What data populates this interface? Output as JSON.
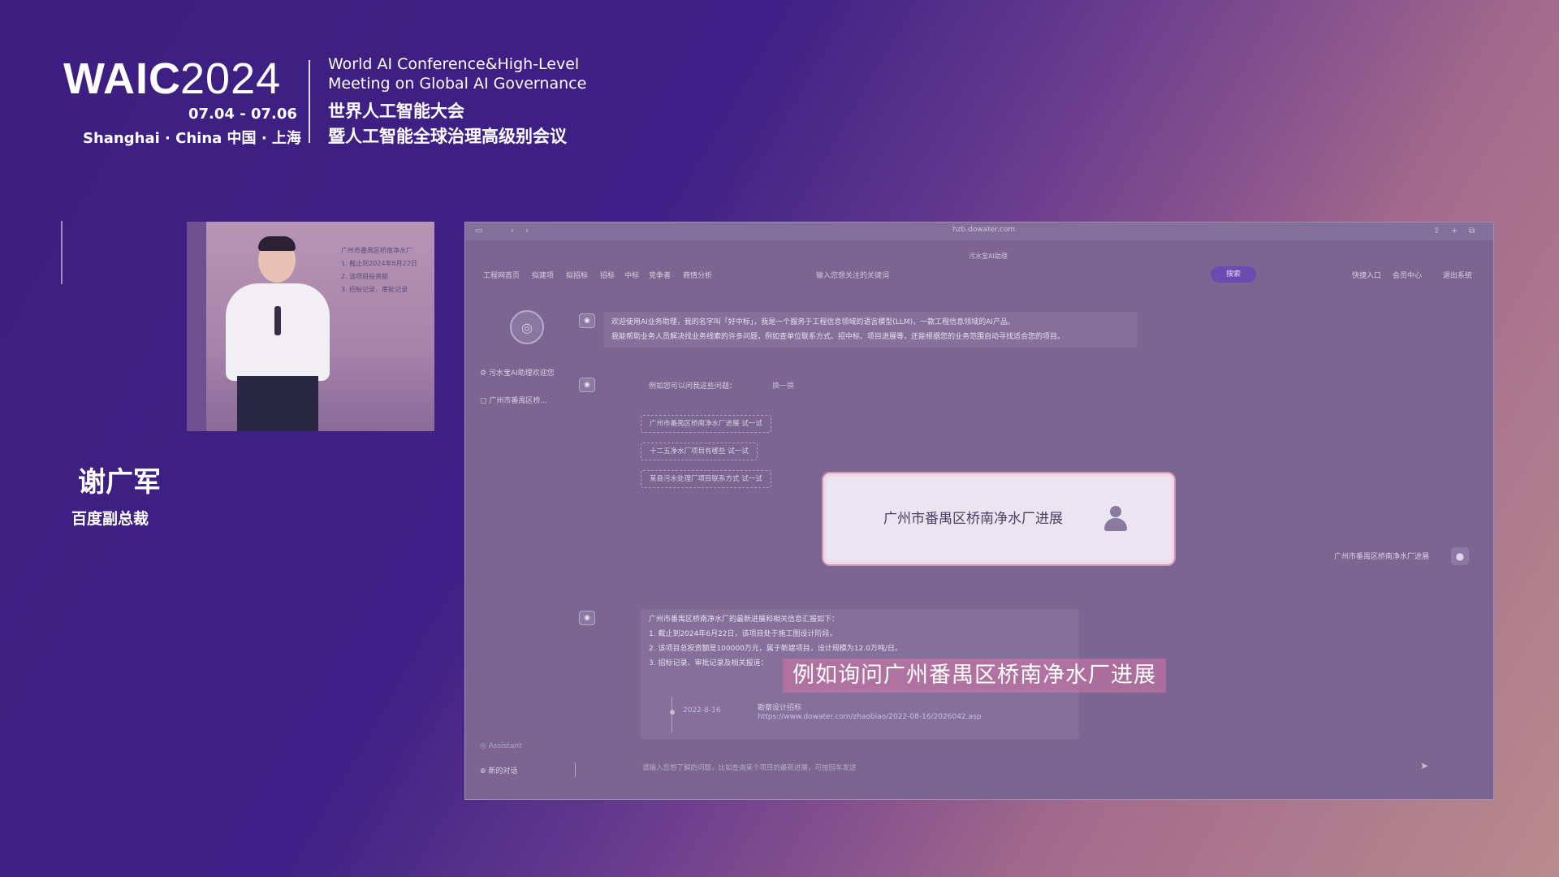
{
  "event": {
    "logo_word": "WAIC",
    "logo_year": "2024",
    "dates": "07.04 - 07.06",
    "location": "Shanghai · China  中国 · 上海",
    "name_en_line1": "World AI Conference&High-Level",
    "name_en_line2": "Meeting on Global AI Governance",
    "name_cn_line1": "世界人工智能大会",
    "name_cn_line2": "暨人工智能全球治理高级别会议"
  },
  "speaker": {
    "name": "谢广军",
    "title": "百度副总裁",
    "video_screen_text": [
      "广州市番禺区桥南净水厂",
      "1. 截止到2024年6月22日",
      "2. 该项目投资额",
      "3. 招标记录、审批记录"
    ]
  },
  "browser": {
    "address": "hzb.dowater.com",
    "page_tab": "污水宝AI助理",
    "nav_items": [
      "工程网首页",
      "拟建项",
      "拟招标",
      "招标",
      "中标",
      "竞争者",
      "商情分析"
    ],
    "search_placeholder": "输入您想关注的关键词",
    "search_button": "搜索",
    "nav_right": [
      "快捷入口",
      "会员中心",
      "退出系统"
    ],
    "sidebar": {
      "assistant_label": "污水宝AI助理欢迎您",
      "history_item": "广州市番禺区桥...",
      "footer_item": "Assistant",
      "new_chat": "新的对话"
    },
    "welcome_line1": "欢迎使用AI业务助理，我的名字叫「好中标」，我是一个服务于工程信息领域的语言模型(LLM)，一款工程信息领域的AI产品。",
    "welcome_line2": "我能帮助业务人员解决找业务线索的许多问题，例如查单位联系方式、招中标、项目进展等，还能根据您的业务范围自动寻找适合您的项目。",
    "suggest_title": "例如您可以问我这些问题：",
    "suggest_refresh": "换一换",
    "suggestions": [
      "广州市番禺区桥南净水厂进展  试一试",
      "十二五净水厂项目有哪些  试一试",
      "某县污水处理厂项目联系方式  试一试"
    ],
    "user_echo": "广州市番禺区桥南净水厂进展",
    "answer_lines": [
      "广州市番禺区桥南净水厂的最新进展和相关信息汇报如下：",
      "1. 截止到2024年6月22日，该项目处于施工图设计阶段。",
      "2. 该项目总投资额是100000万元，属于新建项目，设计规模为12.0万吨/日。",
      "3. 招标记录、审批记录及相关报道："
    ],
    "timeline_date": "2022-8-16",
    "timeline_title": "勘察设计招标",
    "timeline_url": "https://www.dowater.com/zhaobiao/2022-08-16/2026042.asp",
    "chat_input_placeholder": "请输入您想了解的问题，比如查询某个项目的最新进展，可按回车发送"
  },
  "highlight_bubble_text": "广州市番禺区桥南净水厂进展",
  "subtitle": "例如询问广州番禺区桥南净水厂进展",
  "icons": {
    "bot": "robot-icon",
    "user": "user-icon",
    "send": "send-icon",
    "sidebar": "gear-icon"
  },
  "colors": {
    "background_left": "#3d1f80",
    "background_right": "#b98a8e",
    "subtitle_bg": "#d676a8",
    "search_button": "#6b4bb0"
  }
}
